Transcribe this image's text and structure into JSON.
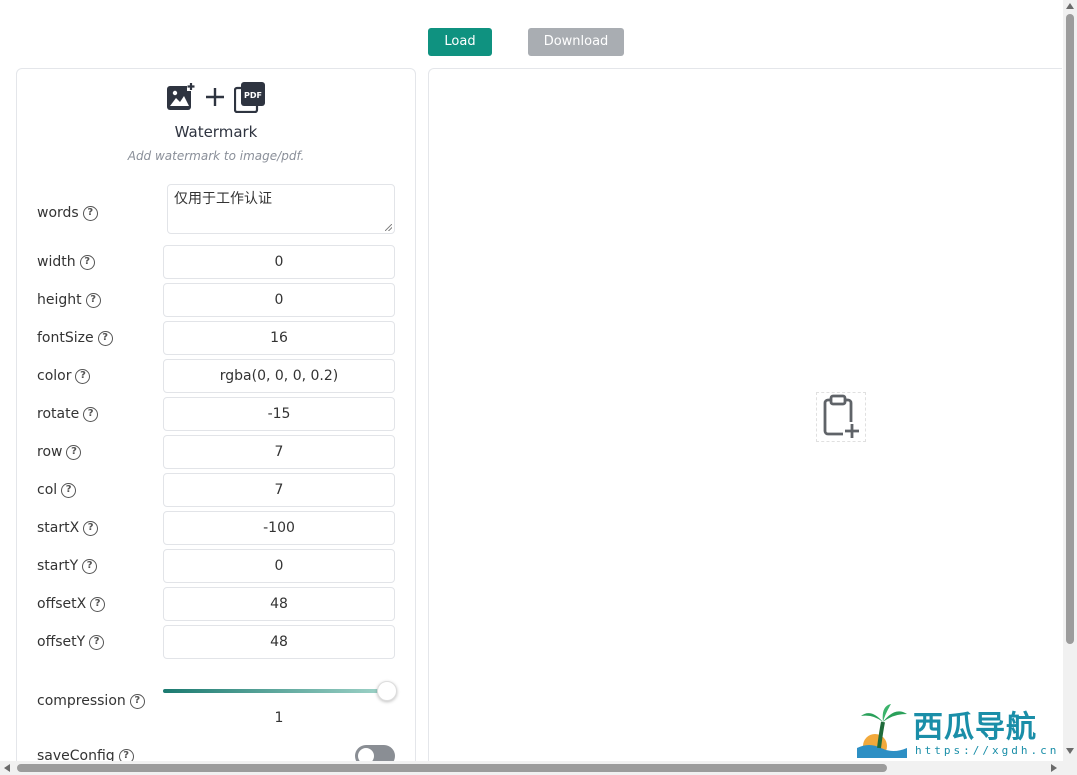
{
  "toolbar": {
    "load_label": "Load",
    "download_label": "Download"
  },
  "panel": {
    "title": "Watermark",
    "subtitle": "Add watermark to image/pdf.",
    "words": {
      "label": "words",
      "value": "仅用于工作认证"
    },
    "fields": [
      {
        "label": "width",
        "value": "0"
      },
      {
        "label": "height",
        "value": "0"
      },
      {
        "label": "fontSize",
        "value": "16"
      },
      {
        "label": "color",
        "value": "rgba(0, 0, 0, 0.2)"
      },
      {
        "label": "rotate",
        "value": "-15"
      },
      {
        "label": "row",
        "value": "7"
      },
      {
        "label": "col",
        "value": "7"
      },
      {
        "label": "startX",
        "value": "-100"
      },
      {
        "label": "startY",
        "value": "0"
      },
      {
        "label": "offsetX",
        "value": "48"
      },
      {
        "label": "offsetY",
        "value": "48"
      }
    ],
    "compression": {
      "label": "compression",
      "value": "1",
      "level": 1.0
    },
    "saveConfig": {
      "label": "saveConfig",
      "on": false
    },
    "help_glyph": "?"
  },
  "preview": {
    "icon": "clipboard-plus-icon"
  },
  "watermark_overlay": {
    "text": "西瓜导航",
    "url": "https://xgdh.cn"
  },
  "colors": {
    "accent": "#0f9280",
    "disabled": "#a9adb2",
    "toggle_off": "#8a8e94"
  }
}
